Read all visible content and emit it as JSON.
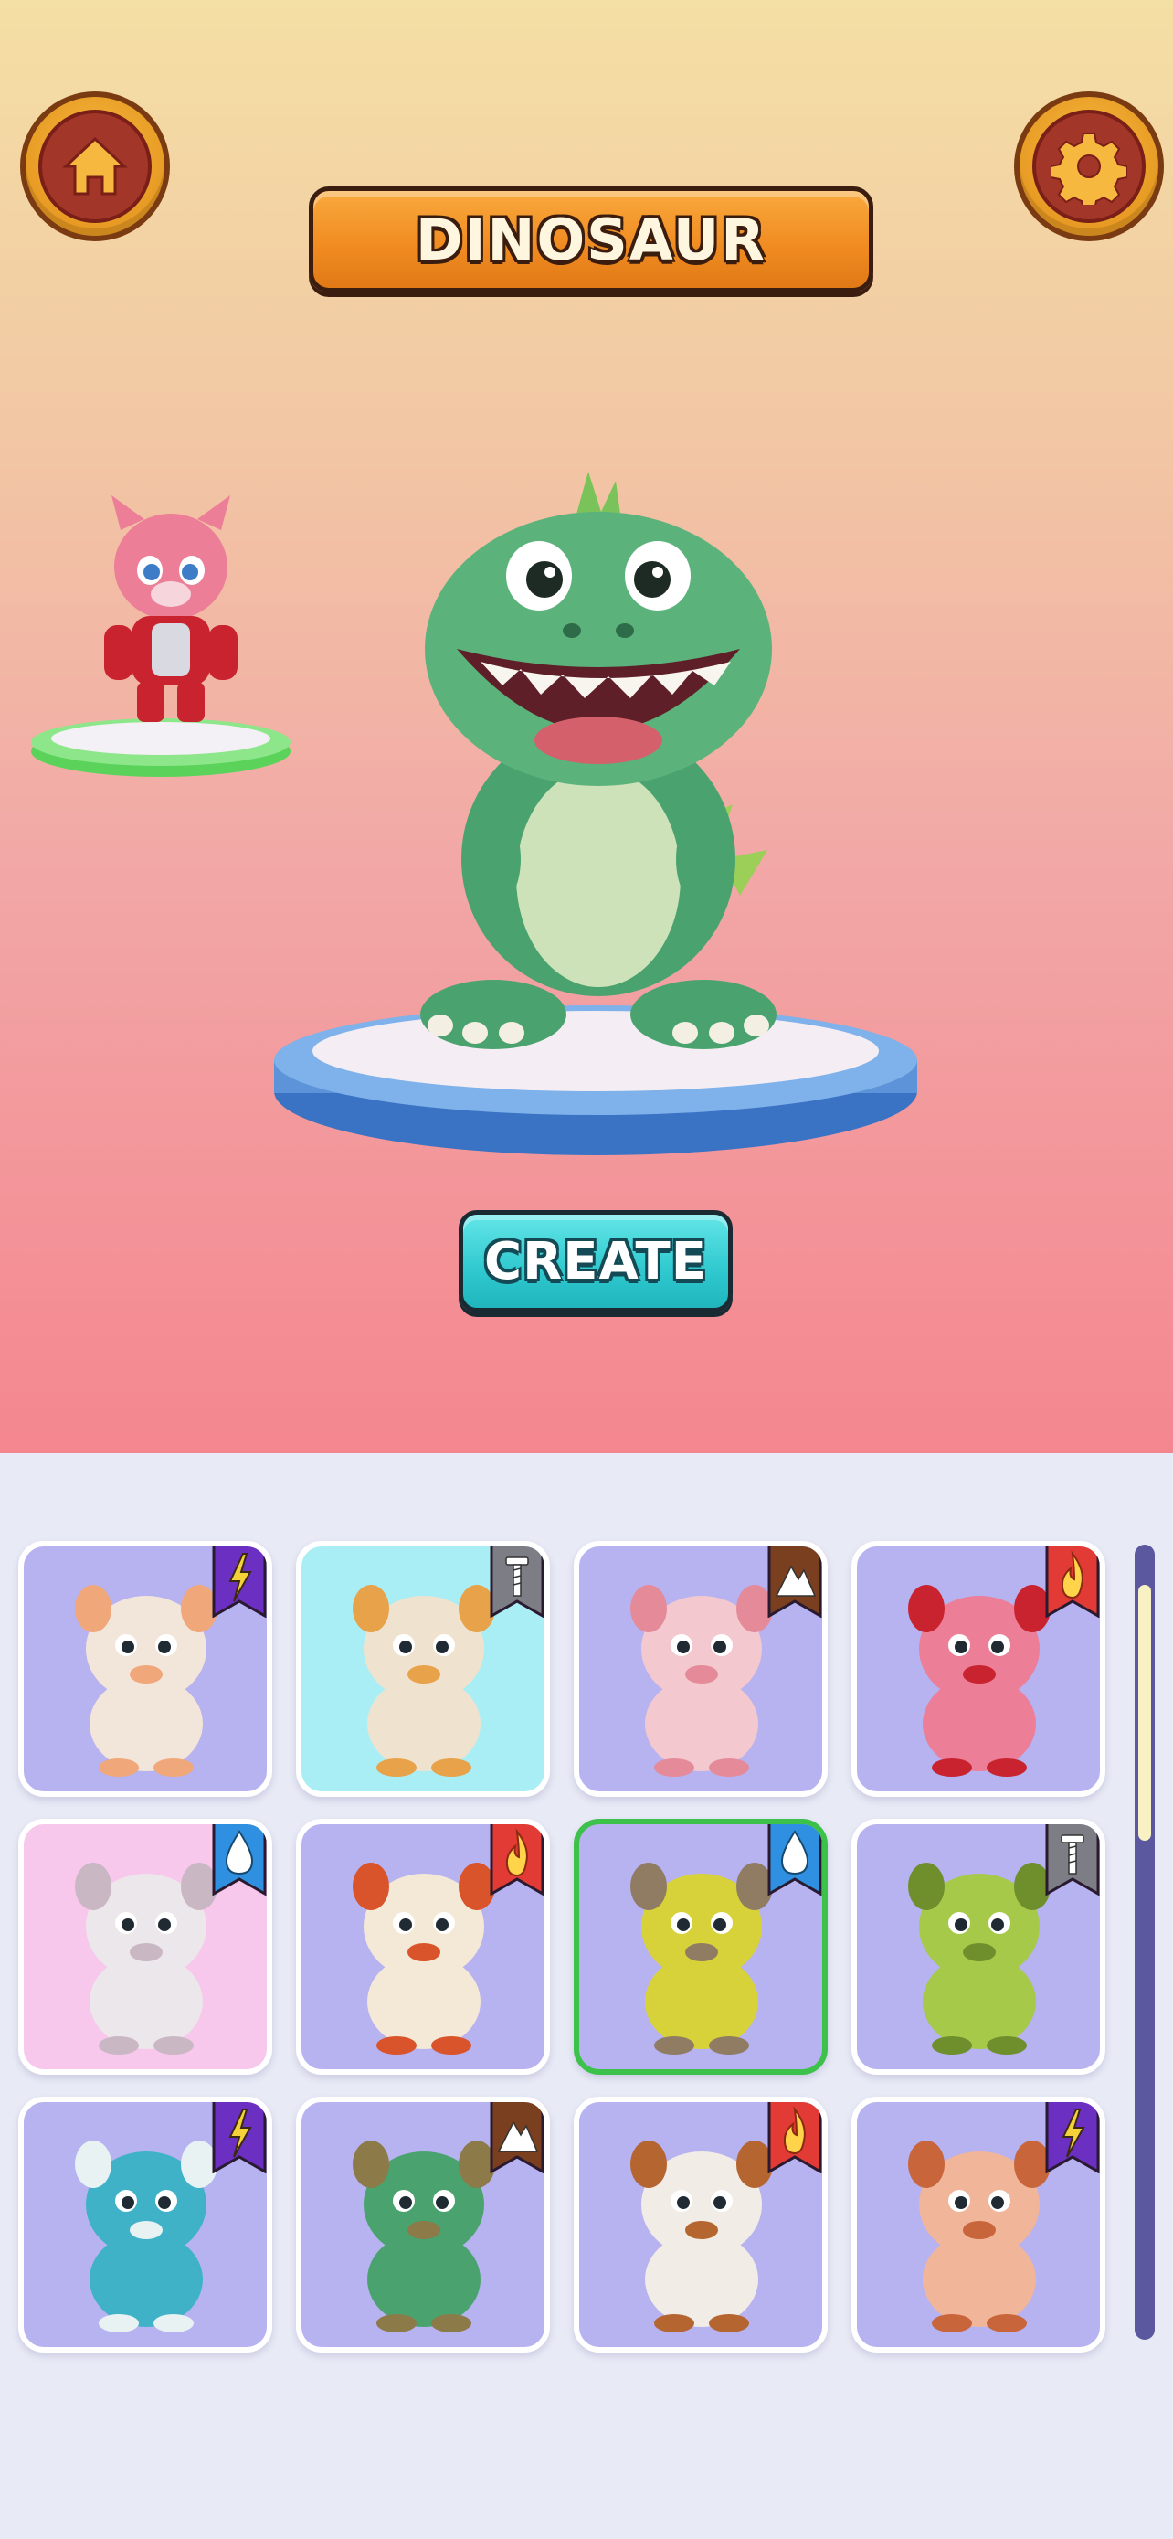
{
  "header": {
    "title": "DINOSAUR"
  },
  "buttons": {
    "create_label": "CREATE"
  },
  "colors": {
    "card_default": "#b7b2f0",
    "card_cyan": "#a9eef5",
    "card_pink": "#f8c7ec",
    "selected_border": "#3cc14b",
    "flag_purple": "#6b2fc2",
    "flag_gray": "#7d7d86",
    "flag_brown": "#7a3f1e",
    "flag_red": "#e23a34",
    "flag_blue": "#2f8fe0"
  },
  "inventory": {
    "cards": [
      {
        "name": "bunny",
        "bg": "card_default",
        "element": "lightning-icon",
        "flag": "flag_purple"
      },
      {
        "name": "crested-creature",
        "bg": "card_cyan",
        "element": "screw-icon",
        "flag": "flag_gray"
      },
      {
        "name": "pig",
        "bg": "card_default",
        "element": "mountain-icon",
        "flag": "flag_brown"
      },
      {
        "name": "armored-cat",
        "bg": "card_default",
        "element": "fire-icon",
        "flag": "flag_red"
      },
      {
        "name": "elephant",
        "bg": "card_pink",
        "element": "water-drop-icon",
        "flag": "flag_blue"
      },
      {
        "name": "rooster",
        "bg": "card_default",
        "element": "fire-icon",
        "flag": "flag_red"
      },
      {
        "name": "banana-cat",
        "bg": "card_default",
        "element": "water-drop-icon",
        "flag": "flag_blue",
        "selected": true
      },
      {
        "name": "frog",
        "bg": "card_default",
        "element": "screw-icon",
        "flag": "flag_gray"
      },
      {
        "name": "shark",
        "bg": "card_default",
        "element": "lightning-icon",
        "flag": "flag_purple"
      },
      {
        "name": "turtle-croc",
        "bg": "card_default",
        "element": "mountain-icon",
        "flag": "flag_brown"
      },
      {
        "name": "goat",
        "bg": "card_default",
        "element": "fire-icon",
        "flag": "flag_red"
      },
      {
        "name": "tiger-pig",
        "bg": "card_default",
        "element": "lightning-icon",
        "flag": "flag_purple"
      }
    ]
  }
}
